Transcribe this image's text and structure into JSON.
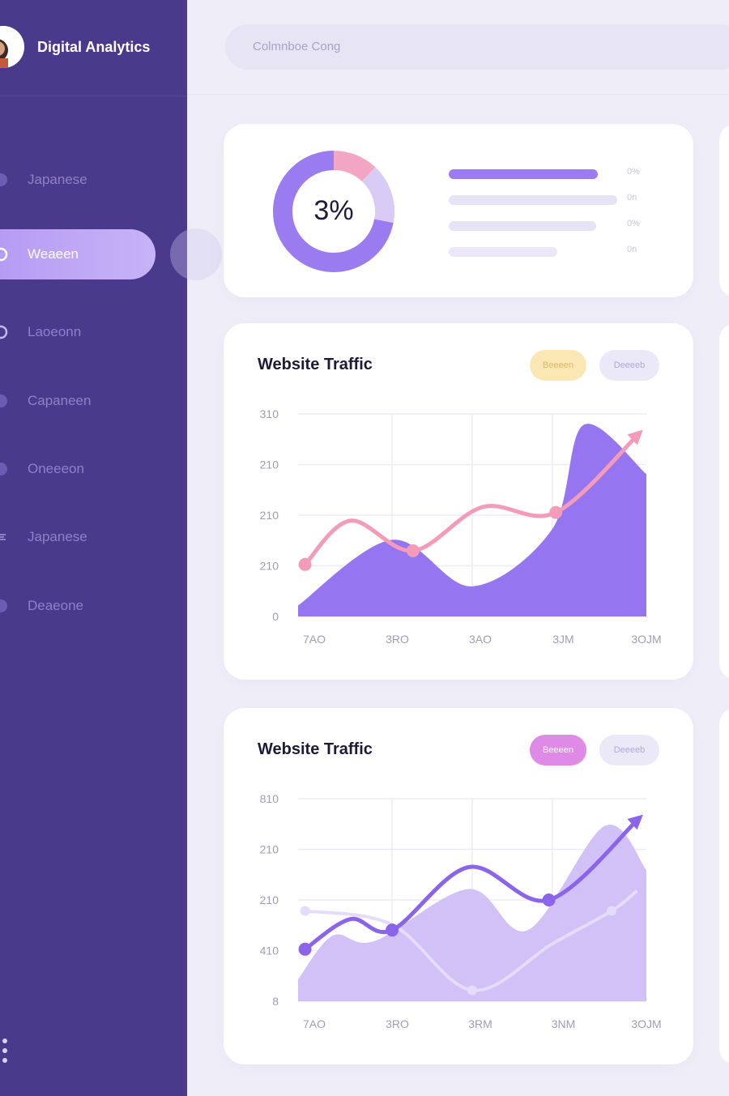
{
  "brand": {
    "title": "Digital Analytics"
  },
  "search": {
    "placeholder": "Colmnboe Cong"
  },
  "sidebar": {
    "items": [
      {
        "label": "Japanese",
        "icon": "circle-icon",
        "active": false
      },
      {
        "label": "Weaeen",
        "icon": "circle-outline-icon",
        "active": true
      },
      {
        "label": "Laoeonn",
        "icon": "circle-outline-icon",
        "active": false
      },
      {
        "label": "Capaneen",
        "icon": "circle-icon",
        "active": false
      },
      {
        "label": "Oneeeon",
        "icon": "circle-icon",
        "active": false
      },
      {
        "label": "Japanese",
        "icon": "e-icon",
        "active": false
      },
      {
        "label": "Deaeone",
        "icon": "circle-icon",
        "active": false
      }
    ]
  },
  "summary": {
    "center_value": "3%",
    "donut_segments": [
      {
        "value": 72,
        "color": "#9b7bf0"
      },
      {
        "value": 12,
        "color": "#f2a6c4"
      },
      {
        "value": 16,
        "color": "#d8ccf6"
      }
    ],
    "bars": [
      {
        "fill": 1.0,
        "color": "#9b7bf0",
        "value": "0%"
      },
      {
        "fill": 1.0,
        "color": "#e7e3f7",
        "value": "0n"
      },
      {
        "fill": 0.94,
        "color": "#e7e3f7",
        "value": "0%"
      },
      {
        "fill": 0.8,
        "color": "#ebe7f8",
        "value": "0n"
      }
    ]
  },
  "charts": [
    {
      "title": "Website Traffic",
      "pill_a": {
        "label": "Beeeen",
        "bg": "#fbe7b3",
        "color": "#d9b86a"
      },
      "pill_b": {
        "label": "Deeeeb"
      },
      "y_ticks": [
        "310",
        "210",
        "210",
        "210",
        "0"
      ],
      "x_ticks": [
        "7AO",
        "3RO",
        "3AO",
        "3JM",
        "3OJM"
      ]
    },
    {
      "title": "Website Traffic",
      "pill_a": {
        "label": "Beeeen",
        "bg": "#e08ae8",
        "color": "#ffffff"
      },
      "pill_b": {
        "label": "Deeeeb"
      },
      "y_ticks": [
        "810",
        "210",
        "210",
        "410",
        "8"
      ],
      "x_ticks": [
        "7AO",
        "3RO",
        "3RM",
        "3NM",
        "3OJM"
      ]
    }
  ],
  "chart_data": [
    {
      "type": "area",
      "title": "Website Traffic",
      "x": [
        "7AO",
        "3RO",
        "3AO",
        "3JM",
        "3OJM"
      ],
      "series": [
        {
          "type": "area",
          "color": "#9575f0",
          "values": [
            20,
            140,
            55,
            160,
            350,
            260
          ],
          "x_positions": [
            0,
            0.27,
            0.5,
            0.73,
            0.82,
            1.0
          ]
        },
        {
          "type": "line",
          "color": "#f39bb8",
          "values": [
            95,
            175,
            120,
            200,
            190,
            335
          ],
          "x_positions": [
            0.02,
            0.15,
            0.33,
            0.53,
            0.74,
            0.98
          ]
        }
      ],
      "marker_indices": [
        0,
        2,
        4
      ]
    },
    {
      "type": "line",
      "title": "Website Traffic",
      "x": [
        "7AO",
        "3RO",
        "3RM",
        "3NM",
        "3OJM"
      ],
      "series": [
        {
          "type": "area",
          "color": "#d1c1f7",
          "values": [
            40,
            120,
            110,
            205,
            130,
            320,
            240
          ],
          "x_positions": [
            0,
            0.1,
            0.22,
            0.49,
            0.66,
            0.88,
            1.0
          ]
        },
        {
          "type": "line",
          "color": "#e5dcfb",
          "values": [
            165,
            140,
            20,
            105,
            165,
            200
          ],
          "x_positions": [
            0.02,
            0.27,
            0.5,
            0.73,
            0.9,
            0.97
          ]
        },
        {
          "type": "line",
          "color": "#8a64ea",
          "values": [
            95,
            150,
            130,
            245,
            185,
            335
          ],
          "x_positions": [
            0.02,
            0.15,
            0.27,
            0.49,
            0.72,
            0.98
          ]
        }
      ],
      "marker_indices": [
        0,
        2,
        4
      ]
    }
  ]
}
